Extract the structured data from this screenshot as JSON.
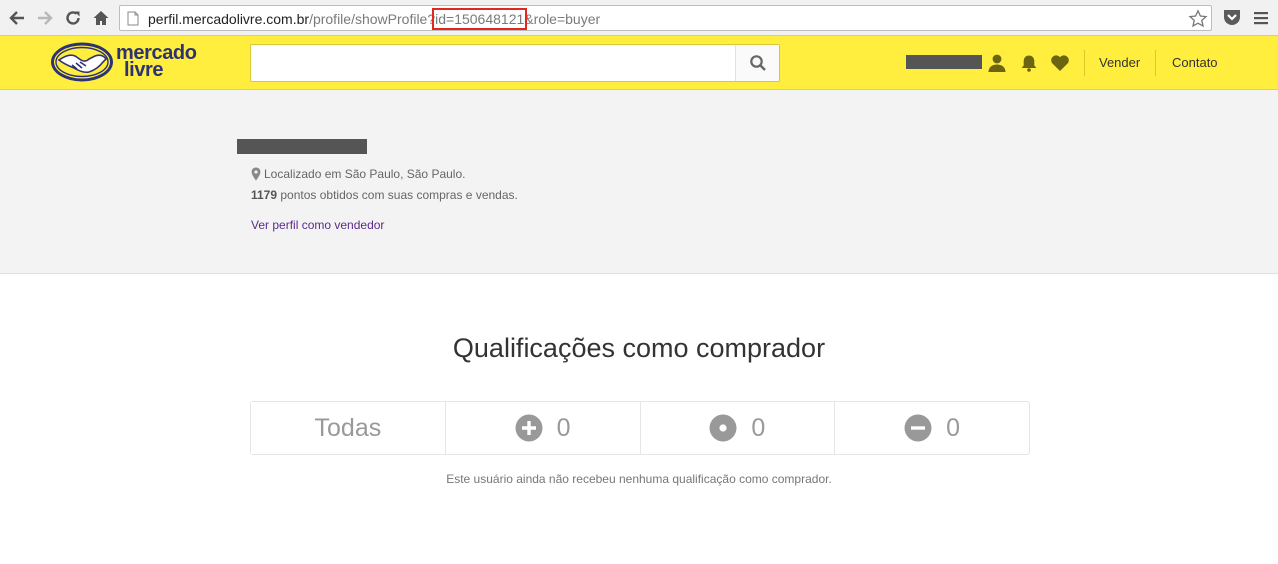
{
  "browser": {
    "url_host": "perfil.mercadolivre.com.br",
    "url_path": "/profile/showProfile?",
    "url_highlight": "id=150648121",
    "url_rest": "&role=buyer"
  },
  "header": {
    "logo_line1": "mercado",
    "logo_line2": "livre",
    "search_placeholder": "",
    "sell_label": "Vender",
    "contact_label": "Contato",
    "brand_color": "#ffee3d"
  },
  "profile": {
    "location": "Localizado em São Paulo, São Paulo.",
    "points_value": "1179",
    "points_text": " pontos obtidos com suas compras e vendas.",
    "seller_link": "Ver perfil como vendedor"
  },
  "ratings": {
    "title": "Qualificações como comprador",
    "all_label": "Todas",
    "positive_count": "0",
    "neutral_count": "0",
    "negative_count": "0",
    "empty_message": "Este usuário ainda não recebeu nenhuma qualificação como comprador."
  }
}
